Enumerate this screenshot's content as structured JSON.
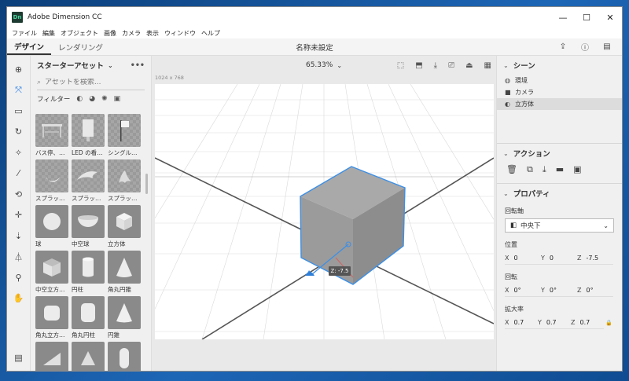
{
  "window": {
    "title": "Adobe Dimension CC",
    "logo_text": "Dn",
    "minimize": "—",
    "maximize": "☐",
    "close": "✕"
  },
  "menu": [
    "ファイル",
    "編集",
    "オブジェクト",
    "画像",
    "カメラ",
    "表示",
    "ウィンドウ",
    "ヘルプ"
  ],
  "tabs": [
    {
      "label": "デザイン",
      "active": true
    },
    {
      "label": "レンダリング",
      "active": false
    }
  ],
  "document_title": "名称未設定",
  "toolbar": [
    "add-icon",
    "select-icon",
    "frame-icon",
    "orbit-icon",
    "magic-wand-icon",
    "eyedropper-icon",
    "pan-icon",
    "move-icon",
    "dolly-icon",
    "horizon-icon",
    "zoom-icon",
    "hand-icon"
  ],
  "assets": {
    "title": "スターターアセット",
    "search_placeholder": "アセットを検索...",
    "filter_label": "フィルター",
    "items": [
      {
        "label": "バス停、…",
        "type": "bus-stop"
      },
      {
        "label": "LED の看…",
        "type": "led-sign"
      },
      {
        "label": "シングル…",
        "type": "flag"
      },
      {
        "label": "スプラッ…",
        "type": "splash1"
      },
      {
        "label": "スプラッ…",
        "type": "splash2"
      },
      {
        "label": "スプラッ…",
        "type": "splash3"
      },
      {
        "label": "球",
        "type": "sphere"
      },
      {
        "label": "中空球",
        "type": "hollow-sphere"
      },
      {
        "label": "立方体",
        "type": "cube"
      },
      {
        "label": "中空立方…",
        "type": "hollow-cube"
      },
      {
        "label": "円柱",
        "type": "cylinder"
      },
      {
        "label": "角丸円錐",
        "type": "rounded-cone"
      },
      {
        "label": "角丸立方…",
        "type": "rounded-cube"
      },
      {
        "label": "角丸円柱",
        "type": "rounded-cylinder"
      },
      {
        "label": "円錐",
        "type": "cone"
      },
      {
        "label": "",
        "type": "wedge"
      },
      {
        "label": "",
        "type": "prism"
      },
      {
        "label": "",
        "type": "capsule"
      }
    ]
  },
  "viewport": {
    "zoom": "65.33%",
    "canvas_size": "1024 x 768",
    "z_badge": "Z: -7.5"
  },
  "scene": {
    "title": "シーン",
    "items": [
      {
        "label": "環境",
        "icon": "globe-icon",
        "selected": false
      },
      {
        "label": "カメラ",
        "icon": "camera-icon",
        "selected": false
      },
      {
        "label": "立方体",
        "icon": "cube-icon",
        "selected": true
      }
    ]
  },
  "actions": {
    "title": "アクション"
  },
  "properties": {
    "title": "プロパティ",
    "pivot_label": "回転軸",
    "pivot_value": "中央下",
    "position_label": "位置",
    "position": {
      "x": "0",
      "y": "0",
      "z": "-7.5"
    },
    "rotation_label": "回転",
    "rotation": {
      "x": "0°",
      "y": "0°",
      "z": "0°"
    },
    "scale_label": "拡大率",
    "scale": {
      "x": "0.7",
      "y": "0.7",
      "z": "0.7"
    }
  },
  "colors": {
    "accent": "#1473e6",
    "cube_outline": "#3d8fe6"
  }
}
